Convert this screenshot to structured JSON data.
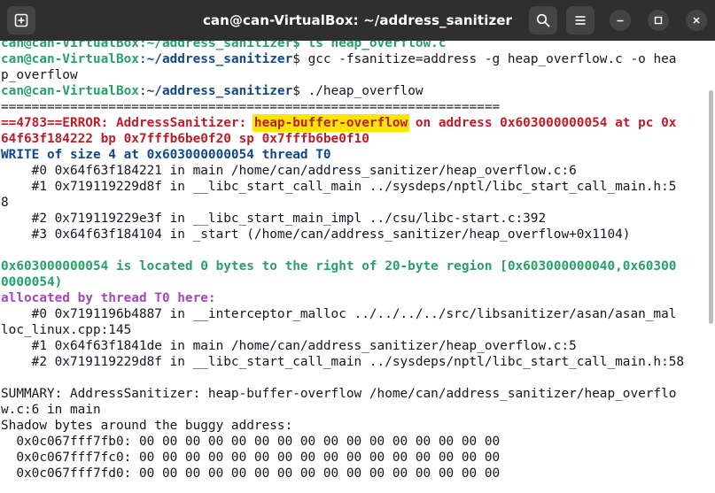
{
  "window": {
    "title": "can@can-VirtualBox: ~/address_sanitizer",
    "new_tab_icon": "new-tab-icon",
    "search_icon": "search-icon",
    "menu_icon": "hamburger-menu-icon",
    "minimize_icon": "minimize-icon",
    "maximize_icon": "maximize-icon",
    "close_icon": "close-icon"
  },
  "terminal": {
    "partial_top_line": "can@can-VirtualBox:~/address_sanitizer$ ls heap_overflow.c",
    "prompt_user": "can@can-VirtualBox",
    "prompt_sep": ":",
    "prompt_path": "~/address_sanitizer",
    "prompt_dollar": "$ ",
    "cmd1_line1": "gcc -fsanitize=address -g heap_overflow.c -o hea",
    "cmd1_line2": "p_overflow",
    "cmd2": "./heap_overflow",
    "separator": "=================================================================",
    "error_prefix": "==4783==ERROR: AddressSanitizer: ",
    "error_type": "heap-buffer-overflow",
    "error_suffix": " on address 0x603000000054 at pc 0x",
    "error_line2": "64f63f184222 bp 0x7fffb6be0f20 sp 0x7fffb6be0f10",
    "write_line": "WRITE of size 4 at 0x603000000054 thread T0",
    "frame0": "    #0 0x64f63f184221 in main /home/can/address_sanitizer/heap_overflow.c:6",
    "frame1a": "    #1 0x719119229d8f in __libc_start_call_main ../sysdeps/nptl/libc_start_call_main.h:5",
    "frame1b": "8",
    "frame2": "    #2 0x719119229e3f in __libc_start_main_impl ../csu/libc-start.c:392",
    "frame3": "    #3 0x64f63f184104 in _start (/home/can/address_sanitizer/heap_overflow+0x1104)",
    "located_line1": "0x603000000054 is located 0 bytes to the right of 20-byte region [0x603000000040,0x60300",
    "located_line2": "0000054)",
    "allocated_line": "allocated by thread T0 here:",
    "alloc0a": "    #0 0x7191196b4887 in __interceptor_malloc ../../../../src/libsanitizer/asan/asan_mal",
    "alloc0b": "loc_linux.cpp:145",
    "alloc1": "    #1 0x64f63f1841de in main /home/can/address_sanitizer/heap_overflow.c:5",
    "alloc2": "    #2 0x719119229d8f in __libc_start_call_main ../sysdeps/nptl/libc_start_call_main.h:58",
    "summary_line1": "SUMMARY: AddressSanitizer: heap-buffer-overflow /home/can/address_sanitizer/heap_overflo",
    "summary_line2": "w.c:6 in main",
    "shadow_header": "Shadow bytes around the buggy address:",
    "shadow1": "  0x0c067fff7fb0: 00 00 00 00 00 00 00 00 00 00 00 00 00 00 00 00",
    "shadow2": "  0x0c067fff7fc0: 00 00 00 00 00 00 00 00 00 00 00 00 00 00 00 00",
    "shadow3": "  0x0c067fff7fd0: 00 00 00 00 00 00 00 00 00 00 00 00 00 00 00 00"
  },
  "colors": {
    "titlebar": "#2f2f2f",
    "prompt_user": "#26a269",
    "prompt_path": "#12488b",
    "error_red": "#c01c28",
    "highlight_yellow": "#ffe600",
    "allocated_purple": "#a347ba"
  }
}
